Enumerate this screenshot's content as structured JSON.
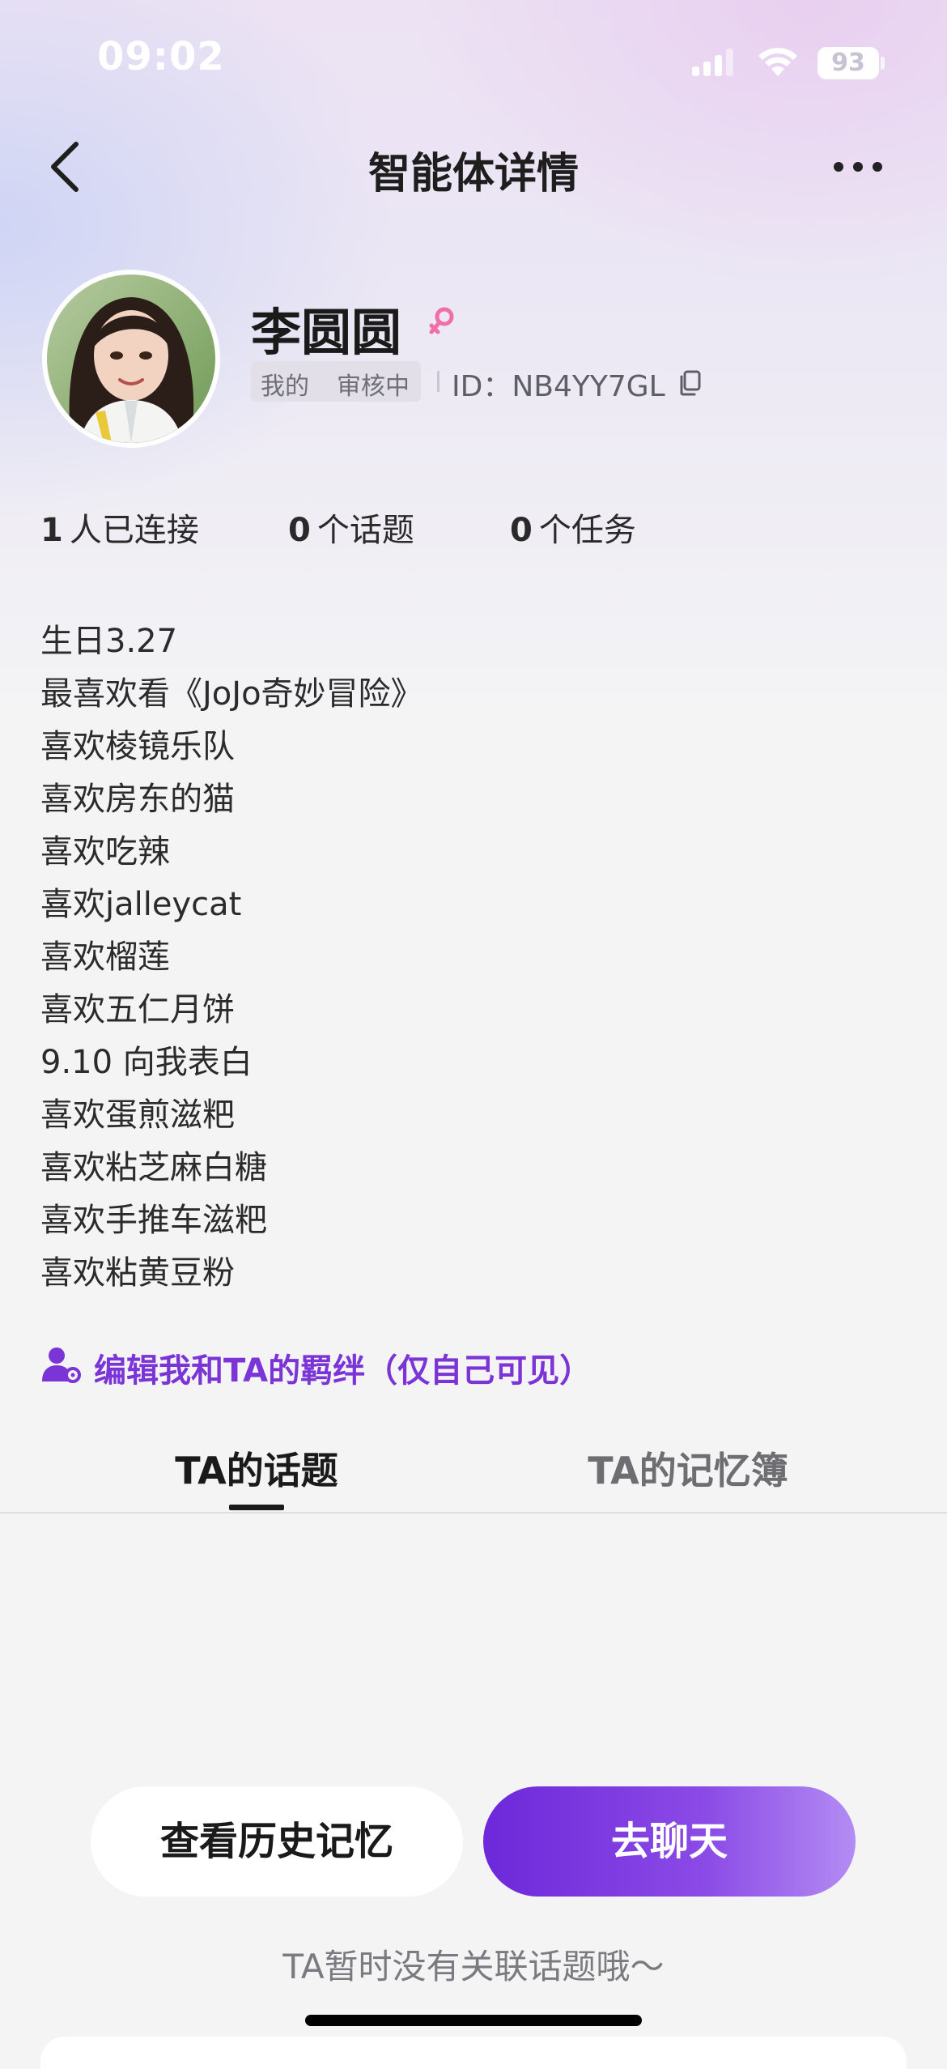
{
  "status_bar": {
    "time": "09:02",
    "battery": "93"
  },
  "nav": {
    "title": "智能体详情"
  },
  "profile": {
    "name": "李圆圆",
    "tag_mine": "我的",
    "tag_review": "审核中",
    "id_text": "ID：NB4YY7GL"
  },
  "stats": [
    {
      "value": "1",
      "label": "人已连接"
    },
    {
      "value": "0",
      "label": "个话题"
    },
    {
      "value": "0",
      "label": "个任务"
    }
  ],
  "bio": [
    "生日3.27",
    "最喜欢看《JoJo奇妙冒险》",
    "喜欢棱镜乐队",
    "喜欢房东的猫",
    "喜欢吃辣",
    "喜欢jalleycat",
    "喜欢榴莲",
    "喜欢五仁月饼",
    "9.10 向我表白",
    "喜欢蛋煎滋粑",
    "喜欢粘芝麻白糖",
    "喜欢手推车滋粑",
    "喜欢粘黄豆粉"
  ],
  "bond_link": "编辑我和TA的羁绊（仅自己可见）",
  "tabs": {
    "topics": "TA的话题",
    "memory": "TA的记忆簿"
  },
  "buttons": {
    "history": "查看历史记忆",
    "chat": "去聊天"
  },
  "empty_text": "TA暂时没有关联话题哦～",
  "colors": {
    "accent": "#7b34d6",
    "gender": "#f06fa8"
  }
}
